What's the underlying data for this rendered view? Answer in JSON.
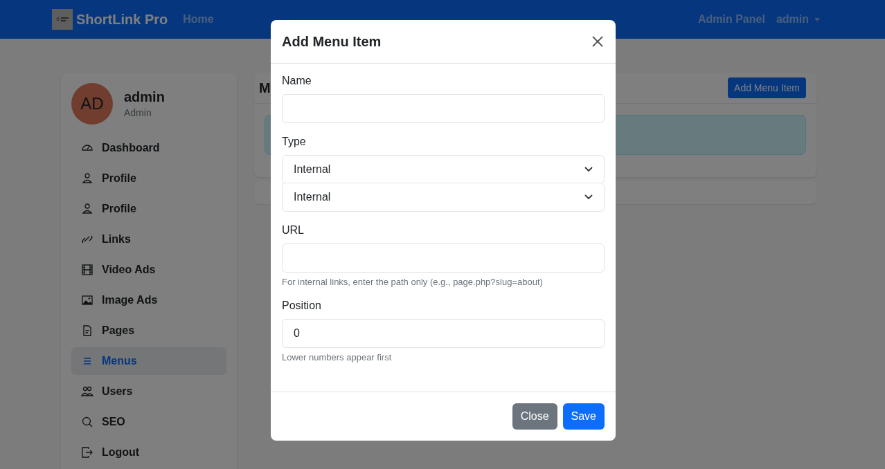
{
  "navbar": {
    "brand": "ShortLink Pro",
    "links": [
      {
        "label": "Home"
      }
    ],
    "right_links": [
      {
        "label": "Admin Panel"
      }
    ],
    "user_menu": {
      "label": "admin"
    }
  },
  "sidebar": {
    "avatar": "AD",
    "user_name": "admin",
    "role": "Admin",
    "items": [
      {
        "label": "Dashboard",
        "selected": false
      },
      {
        "label": "Profile",
        "selected": false
      },
      {
        "label": "Profile",
        "selected": false
      },
      {
        "label": "Links",
        "selected": false
      },
      {
        "label": "Video Ads",
        "selected": false
      },
      {
        "label": "Image Ads",
        "selected": false
      },
      {
        "label": "Pages",
        "selected": false
      },
      {
        "label": "Menus",
        "selected": true
      },
      {
        "label": "Users",
        "selected": false
      },
      {
        "label": "SEO",
        "selected": false
      },
      {
        "label": "Logout",
        "selected": false
      }
    ]
  },
  "main_card": {
    "title": "M",
    "add_button": "Add Menu Item"
  },
  "modal": {
    "title": "Add Menu Item",
    "fields": [
      {
        "kind": "text",
        "label": "Name"
      },
      {
        "kind": "select",
        "label": "Type",
        "value": "Internal"
      },
      {
        "kind": "select",
        "value": "Internal"
      },
      {
        "kind": "text",
        "label": "URL",
        "help": "For internal links, enter the path only (e.g., page.php?slug=about)"
      },
      {
        "kind": "text",
        "label": "Position",
        "value": "0",
        "help": "Lower numbers appear first"
      }
    ],
    "buttons": [
      {
        "label": "Close",
        "kind": "secondary"
      },
      {
        "label": "Save",
        "kind": "primary"
      }
    ]
  }
}
